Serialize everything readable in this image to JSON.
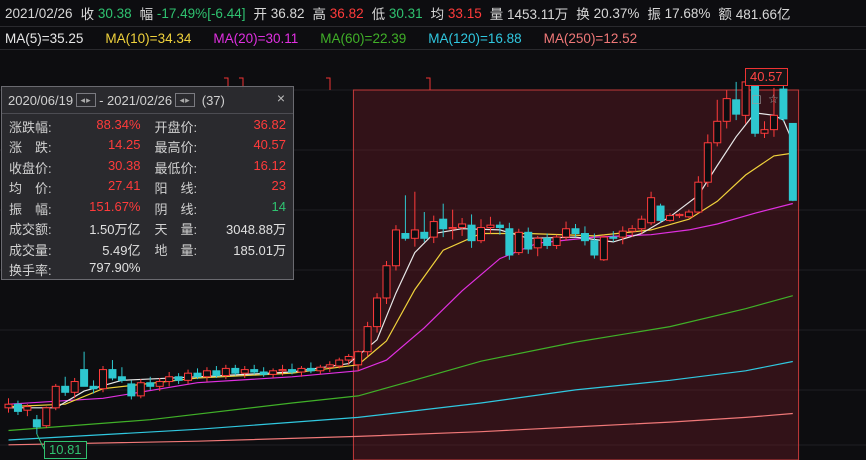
{
  "header": {
    "date": "2021/02/26",
    "close_label": "收",
    "close_value": "30.38",
    "change_label": "幅",
    "change_value": "-17.49%[-6.44]",
    "open_label": "开",
    "open_value": "36.82",
    "high_label": "高",
    "high_value": "36.82",
    "low_label": "低",
    "low_value": "30.31",
    "avg_label": "均",
    "avg_value": "33.15",
    "volume_label": "量",
    "volume_value": "1453.11万",
    "turnover_label": "换",
    "turnover_value": "20.37%",
    "amplitude_label": "振",
    "amplitude_value": "17.68%",
    "amount_label": "额",
    "amount_value": "481.66亿"
  },
  "ma_bar": {
    "ma5": "MA(5)=35.25",
    "ma10": "MA(10)=34.34",
    "ma20": "MA(20)=30.11",
    "ma60": "MA(60)=22.39",
    "ma120": "MA(120)=16.88",
    "ma250": "MA(250)=12.52"
  },
  "panel": {
    "start_date": "2020/06/19",
    "separator": "-",
    "end_date": "2021/02/26",
    "days": "(37)",
    "close_icon": "×",
    "rows": [
      [
        {
          "label": "涨跌幅:",
          "value": "88.34%",
          "color": "#ff3b3b"
        },
        {
          "label": "开盘价:",
          "value": "36.82",
          "color": "#ff3b3b"
        }
      ],
      [
        {
          "label": "涨　跌:",
          "value": "14.25",
          "color": "#ff3b3b"
        },
        {
          "label": "最高价:",
          "value": "40.57",
          "color": "#ff3b3b"
        }
      ],
      [
        {
          "label": "收盘价:",
          "value": "30.38",
          "color": "#ff3b3b"
        },
        {
          "label": "最低价:",
          "value": "16.12",
          "color": "#ff3b3b"
        }
      ],
      [
        {
          "label": "均　价:",
          "value": "27.41",
          "color": "#ff3b3b"
        },
        {
          "label": "阳　线:",
          "value": "23",
          "color": "#ff3b3b"
        }
      ],
      [
        {
          "label": "振　幅:",
          "value": "151.67%",
          "color": "#ff3b3b"
        },
        {
          "label": "阴　线:",
          "value": "14",
          "color": "#2fc270"
        }
      ],
      [
        {
          "label": "成交额:",
          "value": "1.50万亿",
          "color": "#e0e0e0"
        },
        {
          "label": "天　量:",
          "value": "3048.88万",
          "color": "#e0e0e0"
        }
      ],
      [
        {
          "label": "成交量:",
          "value": "5.49亿",
          "color": "#e0e0e0"
        },
        {
          "label": "地　量:",
          "value": "185.01万",
          "color": "#e0e0e0"
        }
      ],
      [
        {
          "label": "换手率:",
          "value": "797.90%",
          "color": "#e0e0e0"
        },
        {
          "label": "",
          "value": "",
          "color": "#e0e0e0"
        }
      ]
    ]
  },
  "tags": {
    "high_price": "40.57",
    "low_price": "10.81"
  },
  "colors": {
    "up": "#ff3b3b",
    "down": "#2fc270",
    "flat": "#2ec8d0",
    "ma5": "#e8e8e8",
    "ma10": "#f0d23c",
    "ma20": "#e030e0",
    "ma60": "#40b028",
    "ma120": "#30c8e0",
    "ma250": "#f07878",
    "selection_fill": "rgba(120,30,40,0.35)",
    "selection_border": "#c23a3a"
  },
  "chart_data": {
    "type": "candlestick",
    "ylim": [
      9.8,
      41.8
    ],
    "selection_start_index": 37,
    "candles": [
      {
        "o": 13.0,
        "h": 13.8,
        "l": 12.6,
        "c": 13.3
      },
      {
        "o": 13.3,
        "h": 13.6,
        "l": 12.4,
        "c": 12.7
      },
      {
        "o": 12.8,
        "h": 13.3,
        "l": 12.3,
        "c": 13.1
      },
      {
        "o": 12.0,
        "h": 12.4,
        "l": 10.8,
        "c": 11.4
      },
      {
        "o": 11.5,
        "h": 13.1,
        "l": 11.3,
        "c": 13.0
      },
      {
        "o": 13.0,
        "h": 15.0,
        "l": 12.8,
        "c": 14.8
      },
      {
        "o": 14.8,
        "h": 15.6,
        "l": 14.0,
        "c": 14.3
      },
      {
        "o": 14.3,
        "h": 15.5,
        "l": 13.8,
        "c": 15.2
      },
      {
        "o": 16.2,
        "h": 17.7,
        "l": 15.8,
        "c": 14.8
      },
      {
        "o": 14.8,
        "h": 15.3,
        "l": 14.2,
        "c": 14.6
      },
      {
        "o": 14.6,
        "h": 16.5,
        "l": 14.3,
        "c": 16.2
      },
      {
        "o": 16.2,
        "h": 17.0,
        "l": 15.3,
        "c": 15.5
      },
      {
        "o": 15.6,
        "h": 16.4,
        "l": 15.1,
        "c": 15.3
      },
      {
        "o": 15.0,
        "h": 15.3,
        "l": 13.7,
        "c": 14.0
      },
      {
        "o": 14.0,
        "h": 15.4,
        "l": 13.8,
        "c": 15.1
      },
      {
        "o": 15.1,
        "h": 15.6,
        "l": 14.5,
        "c": 14.8
      },
      {
        "o": 14.8,
        "h": 15.5,
        "l": 14.4,
        "c": 15.2
      },
      {
        "o": 15.2,
        "h": 16.0,
        "l": 14.8,
        "c": 15.6
      },
      {
        "o": 15.6,
        "h": 15.9,
        "l": 15.0,
        "c": 15.3
      },
      {
        "o": 15.3,
        "h": 16.2,
        "l": 15.0,
        "c": 15.9
      },
      {
        "o": 15.9,
        "h": 16.3,
        "l": 15.4,
        "c": 15.6
      },
      {
        "o": 15.6,
        "h": 16.4,
        "l": 15.2,
        "c": 16.1
      },
      {
        "o": 16.1,
        "h": 16.5,
        "l": 15.5,
        "c": 15.7
      },
      {
        "o": 15.7,
        "h": 16.6,
        "l": 15.4,
        "c": 16.3
      },
      {
        "o": 16.3,
        "h": 16.6,
        "l": 15.7,
        "c": 15.9
      },
      {
        "o": 15.9,
        "h": 16.5,
        "l": 15.5,
        "c": 16.2
      },
      {
        "o": 16.2,
        "h": 16.6,
        "l": 15.8,
        "c": 16.0
      },
      {
        "o": 16.0,
        "h": 16.4,
        "l": 15.6,
        "c": 15.8
      },
      {
        "o": 15.8,
        "h": 16.3,
        "l": 15.5,
        "c": 16.1
      },
      {
        "o": 16.1,
        "h": 16.6,
        "l": 15.7,
        "c": 16.2
      },
      {
        "o": 16.2,
        "h": 16.7,
        "l": 15.8,
        "c": 16.0
      },
      {
        "o": 16.0,
        "h": 16.5,
        "l": 15.6,
        "c": 16.3
      },
      {
        "o": 16.3,
        "h": 16.8,
        "l": 15.9,
        "c": 16.1
      },
      {
        "o": 16.1,
        "h": 16.6,
        "l": 15.8,
        "c": 16.4
      },
      {
        "o": 16.4,
        "h": 16.9,
        "l": 16.0,
        "c": 16.6
      },
      {
        "o": 16.5,
        "h": 17.2,
        "l": 16.3,
        "c": 17.0
      },
      {
        "o": 17.0,
        "h": 17.5,
        "l": 16.6,
        "c": 17.3
      },
      {
        "o": 16.6,
        "h": 17.8,
        "l": 16.1,
        "c": 17.7
      },
      {
        "o": 17.7,
        "h": 20.2,
        "l": 17.3,
        "c": 19.8
      },
      {
        "o": 19.8,
        "h": 22.6,
        "l": 19.3,
        "c": 22.2
      },
      {
        "o": 22.2,
        "h": 25.3,
        "l": 21.7,
        "c": 24.9
      },
      {
        "o": 24.9,
        "h": 28.3,
        "l": 24.5,
        "c": 27.9
      },
      {
        "o": 27.6,
        "h": 30.8,
        "l": 27.0,
        "c": 27.2
      },
      {
        "o": 27.2,
        "h": 31.1,
        "l": 26.5,
        "c": 27.9
      },
      {
        "o": 27.7,
        "h": 29.4,
        "l": 26.9,
        "c": 27.2
      },
      {
        "o": 27.3,
        "h": 29.1,
        "l": 26.8,
        "c": 28.6
      },
      {
        "o": 28.8,
        "h": 30.1,
        "l": 27.3,
        "c": 28.0
      },
      {
        "o": 28.0,
        "h": 29.6,
        "l": 27.1,
        "c": 28.1
      },
      {
        "o": 28.1,
        "h": 28.9,
        "l": 27.4,
        "c": 28.4
      },
      {
        "o": 28.3,
        "h": 29.2,
        "l": 26.4,
        "c": 27.0
      },
      {
        "o": 27.0,
        "h": 28.8,
        "l": 26.8,
        "c": 28.1
      },
      {
        "o": 28.1,
        "h": 29.0,
        "l": 27.6,
        "c": 28.3
      },
      {
        "o": 28.3,
        "h": 28.6,
        "l": 27.5,
        "c": 28.1
      },
      {
        "o": 28.0,
        "h": 28.5,
        "l": 25.4,
        "c": 25.8
      },
      {
        "o": 26.0,
        "h": 28.0,
        "l": 25.8,
        "c": 27.7
      },
      {
        "o": 27.7,
        "h": 28.1,
        "l": 25.9,
        "c": 26.3
      },
      {
        "o": 26.4,
        "h": 27.4,
        "l": 25.7,
        "c": 27.2
      },
      {
        "o": 27.2,
        "h": 27.6,
        "l": 26.3,
        "c": 26.6
      },
      {
        "o": 26.6,
        "h": 27.5,
        "l": 26.3,
        "c": 27.3
      },
      {
        "o": 27.3,
        "h": 28.6,
        "l": 27.0,
        "c": 28.0
      },
      {
        "o": 28.0,
        "h": 28.4,
        "l": 27.3,
        "c": 27.6
      },
      {
        "o": 27.6,
        "h": 28.2,
        "l": 26.6,
        "c": 27.0
      },
      {
        "o": 27.0,
        "h": 27.6,
        "l": 25.5,
        "c": 25.8
      },
      {
        "o": 25.4,
        "h": 27.5,
        "l": 25.3,
        "c": 27.3
      },
      {
        "o": 27.3,
        "h": 27.8,
        "l": 26.9,
        "c": 27.3
      },
      {
        "o": 27.3,
        "h": 28.2,
        "l": 26.7,
        "c": 27.8
      },
      {
        "o": 27.8,
        "h": 28.3,
        "l": 27.3,
        "c": 28.0
      },
      {
        "o": 28.0,
        "h": 29.1,
        "l": 27.6,
        "c": 28.8
      },
      {
        "o": 28.5,
        "h": 31.1,
        "l": 28.3,
        "c": 30.6
      },
      {
        "o": 29.9,
        "h": 30.1,
        "l": 28.5,
        "c": 28.7
      },
      {
        "o": 28.7,
        "h": 29.3,
        "l": 28.6,
        "c": 29.1
      },
      {
        "o": 29.1,
        "h": 29.3,
        "l": 28.9,
        "c": 29.2
      },
      {
        "o": 29.0,
        "h": 29.6,
        "l": 28.9,
        "c": 29.4
      },
      {
        "o": 29.4,
        "h": 32.4,
        "l": 29.3,
        "c": 31.9
      },
      {
        "o": 31.9,
        "h": 35.9,
        "l": 31.5,
        "c": 35.2
      },
      {
        "o": 35.2,
        "h": 38.8,
        "l": 34.9,
        "c": 37.0
      },
      {
        "o": 37.0,
        "h": 39.6,
        "l": 36.4,
        "c": 38.9
      },
      {
        "o": 38.8,
        "h": 40.3,
        "l": 37.1,
        "c": 37.6
      },
      {
        "o": 37.5,
        "h": 41.0,
        "l": 36.8,
        "c": 40.3
      },
      {
        "o": 40.3,
        "h": 40.6,
        "l": 35.7,
        "c": 36.0
      },
      {
        "o": 36.0,
        "h": 37.0,
        "l": 35.6,
        "c": 36.3
      },
      {
        "o": 36.3,
        "h": 39.8,
        "l": 35.7,
        "c": 37.5
      },
      {
        "o": 39.7,
        "h": 40.8,
        "l": 37.0,
        "c": 37.2
      },
      {
        "o": 36.82,
        "h": 36.82,
        "l": 30.31,
        "c": 30.38
      }
    ],
    "ma5": [
      [
        0,
        13.0
      ],
      [
        5,
        13.0
      ],
      [
        8,
        14.4
      ],
      [
        12,
        15.3
      ],
      [
        20,
        15.6
      ],
      [
        30,
        16.0
      ],
      [
        36,
        16.7
      ],
      [
        39,
        18.7
      ],
      [
        41,
        22.6
      ],
      [
        43,
        26.0
      ],
      [
        45,
        27.6
      ],
      [
        48,
        28.0
      ],
      [
        52,
        27.9
      ],
      [
        55,
        27.2
      ],
      [
        60,
        27.3
      ],
      [
        64,
        26.9
      ],
      [
        67,
        27.6
      ],
      [
        70,
        29.0
      ],
      [
        73,
        30.8
      ],
      [
        75,
        33.3
      ],
      [
        77,
        35.7
      ],
      [
        79,
        37.7
      ],
      [
        81,
        37.5
      ],
      [
        82,
        37.1
      ],
      [
        83,
        35.25
      ]
    ],
    "ma10": [
      [
        0,
        13.1
      ],
      [
        6,
        13.3
      ],
      [
        10,
        14.6
      ],
      [
        20,
        15.5
      ],
      [
        30,
        15.9
      ],
      [
        37,
        16.6
      ],
      [
        40,
        18.6
      ],
      [
        43,
        22.9
      ],
      [
        46,
        26.2
      ],
      [
        50,
        27.6
      ],
      [
        55,
        27.6
      ],
      [
        62,
        27.4
      ],
      [
        68,
        27.9
      ],
      [
        72,
        28.8
      ],
      [
        75,
        30.3
      ],
      [
        78,
        32.5
      ],
      [
        81,
        34.1
      ],
      [
        83,
        34.34
      ]
    ],
    "ma20": [
      [
        0,
        13.3
      ],
      [
        10,
        13.8
      ],
      [
        20,
        15.1
      ],
      [
        30,
        15.6
      ],
      [
        37,
        16.1
      ],
      [
        40,
        17.0
      ],
      [
        44,
        19.7
      ],
      [
        48,
        22.8
      ],
      [
        52,
        25.5
      ],
      [
        56,
        26.8
      ],
      [
        62,
        27.3
      ],
      [
        68,
        27.5
      ],
      [
        72,
        27.9
      ],
      [
        75,
        28.4
      ],
      [
        79,
        29.3
      ],
      [
        83,
        30.11
      ]
    ],
    "ma60": [
      [
        0,
        11.1
      ],
      [
        15,
        12.0
      ],
      [
        30,
        13.4
      ],
      [
        37,
        14.0
      ],
      [
        42,
        15.1
      ],
      [
        50,
        16.9
      ],
      [
        60,
        18.5
      ],
      [
        70,
        19.8
      ],
      [
        78,
        21.3
      ],
      [
        83,
        22.39
      ]
    ],
    "ma120": [
      [
        0,
        10.3
      ],
      [
        20,
        11.2
      ],
      [
        37,
        12.2
      ],
      [
        50,
        13.4
      ],
      [
        60,
        14.5
      ],
      [
        70,
        15.3
      ],
      [
        78,
        16.1
      ],
      [
        83,
        16.88
      ]
    ],
    "ma250": [
      [
        0,
        9.9
      ],
      [
        20,
        10.2
      ],
      [
        37,
        10.6
      ],
      [
        50,
        11.0
      ],
      [
        60,
        11.4
      ],
      [
        70,
        11.8
      ],
      [
        78,
        12.2
      ],
      [
        83,
        12.52
      ]
    ]
  }
}
